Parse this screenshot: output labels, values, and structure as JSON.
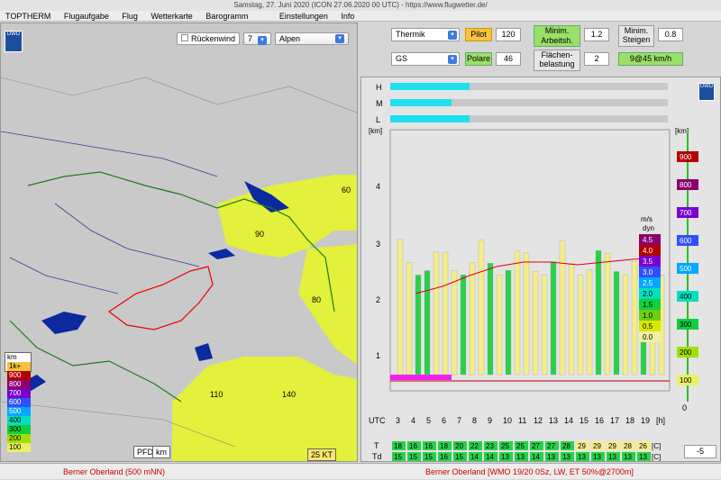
{
  "window": {
    "title": "Samstag, 27. Juni 2020 (ICON 27.06.2020 00 UTC) - https://www.flugwetter.de/"
  },
  "menu": [
    "TOPTHERM",
    "Flugaufgabe",
    "Flug",
    "Wetterkarte",
    "Barogramm",
    "Einstellungen",
    "Info"
  ],
  "map": {
    "rueckenwind_label": "Rückenwind",
    "rueckenwind_value": "7",
    "region": "Alpen",
    "dwd": "DWD",
    "labels": [
      "60",
      "90",
      "80",
      "110",
      "140"
    ],
    "legend_title": "km",
    "legend": [
      {
        "label": "1k+",
        "color": "#f7c23d"
      },
      {
        "label": "900",
        "color": "#b30000"
      },
      {
        "label": "800",
        "color": "#8a006e"
      },
      {
        "label": "700",
        "color": "#7a00d0"
      },
      {
        "label": "600",
        "color": "#3050ff"
      },
      {
        "label": "500",
        "color": "#00a8ff"
      },
      {
        "label": "400",
        "color": "#00e0c0"
      },
      {
        "label": "300",
        "color": "#10d040"
      },
      {
        "label": "200",
        "color": "#a0e000"
      },
      {
        "label": "100",
        "color": "#eaf060"
      }
    ],
    "pfd_label": "PFD",
    "km_label": "km",
    "wind_label": "25 KT"
  },
  "params": {
    "thermik": "Thermik",
    "gs": "GS",
    "pilot_label": "Pilot",
    "pilot_value": "120",
    "polare_label": "Polare",
    "polare_value": "46",
    "min_arb_label": "Minim. Arbeitsh.",
    "min_arb_value": "1.2",
    "flaechen_label": "Flächen-belastung",
    "flaechen_value": "2",
    "min_steigen_label": "Minim. Steigen",
    "min_steigen_value": "0.8",
    "result": "9@45 km/h"
  },
  "chart": {
    "rows": [
      "H",
      "M",
      "L"
    ],
    "km_label": "[km]",
    "y_ticks": [
      "4",
      "3",
      "2",
      "1"
    ],
    "ms_label": "m/s",
    "dyn_label": "dyn",
    "ms_scale": [
      {
        "v": "4.5",
        "c": "#8a006e"
      },
      {
        "v": "4.0",
        "c": "#b30000"
      },
      {
        "v": "3.5",
        "c": "#7a00d0"
      },
      {
        "v": "3.0",
        "c": "#3050ff"
      },
      {
        "v": "2.5",
        "c": "#00a8ff"
      },
      {
        "v": "2.0",
        "c": "#00e0c0"
      },
      {
        "v": "1.5",
        "c": "#10d040"
      },
      {
        "v": "1.0",
        "c": "#6ad010"
      },
      {
        "v": "0.5",
        "c": "#d8e800"
      },
      {
        "v": "0.0",
        "c": "#f0f0a0"
      }
    ],
    "right_scale": [
      {
        "v": "900",
        "c": "#b30000"
      },
      {
        "v": "800",
        "c": "#8a006e"
      },
      {
        "v": "700",
        "c": "#7a00d0"
      },
      {
        "v": "600",
        "c": "#3050ff"
      },
      {
        "v": "500",
        "c": "#00a8ff"
      },
      {
        "v": "400",
        "c": "#00e0c0"
      },
      {
        "v": "300",
        "c": "#10d040"
      },
      {
        "v": "200",
        "c": "#a0e000"
      },
      {
        "v": "100",
        "c": "#eaf060"
      }
    ],
    "right_km": "[km]",
    "right_zero": "0",
    "utc_label": "UTC",
    "hours": [
      "3",
      "4",
      "5",
      "6",
      "7",
      "8",
      "9",
      "10",
      "11",
      "12",
      "13",
      "14",
      "15",
      "16",
      "17",
      "18",
      "19",
      "[h]"
    ],
    "T_label": "T",
    "Td_label": "Td",
    "T": [
      "18",
      "16",
      "16",
      "18",
      "20",
      "22",
      "23",
      "25",
      "25",
      "27",
      "27",
      "28",
      "29",
      "29",
      "29",
      "28",
      "26"
    ],
    "Td": [
      "15",
      "15",
      "15",
      "16",
      "15",
      "14",
      "14",
      "13",
      "13",
      "14",
      "13",
      "13",
      "13",
      "13",
      "13",
      "13",
      "13"
    ],
    "unit_c": "[C]",
    "offset": "-5"
  },
  "status": {
    "left": "Berner Oberland (500 mNN)",
    "right": "Berner Oberland [WMO 19/20 0Sz, LW, ET  50%@2700m]"
  }
}
